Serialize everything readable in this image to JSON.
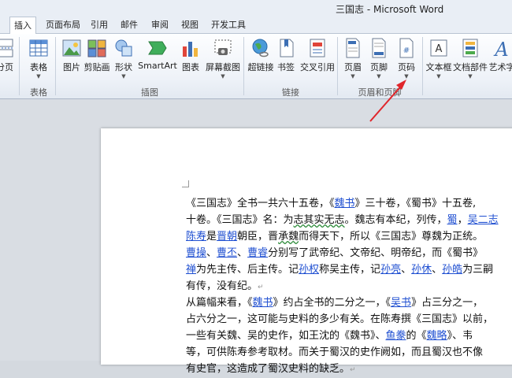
{
  "window": {
    "title": "三国志 - Microsoft Word"
  },
  "tabs": [
    "插入",
    "页面布局",
    "引用",
    "邮件",
    "审阅",
    "视图",
    "开发工具"
  ],
  "ribbon": {
    "partial_left": "分页",
    "buttons": {
      "table": "表格",
      "picture": "图片",
      "clipart": "剪贴画",
      "shapes": "形状",
      "smartart": "SmartArt",
      "chart": "图表",
      "screenshot": "屏幕截图",
      "hyperlink": "超链接",
      "bookmark": "书签",
      "crossref": "交叉引用",
      "header": "页眉",
      "footer": "页脚",
      "pagenum": "页码",
      "textbox": "文本框",
      "quickparts": "文档部件",
      "wordart": "艺术字"
    },
    "groups": {
      "tables": "表格",
      "illustrations": "插图",
      "links": "链接",
      "header_footer": "页眉和页脚"
    }
  },
  "doc": {
    "l1a": "《三国志》全书一共六十五卷，《",
    "l1b": "魏书",
    "l1c": "》三十卷，《蜀书》十五卷,",
    "l2a": "十卷。《三国志》名：为",
    "l2b": "志其实无志",
    "l2c": "。魏志有本纪，列传，",
    "l2d": "蜀",
    "l2e": "，",
    "l2f": "吴二志",
    "l3a": "陈寿",
    "l3b": "是",
    "l3c": "晋朝",
    "l3d": "朝臣，晋",
    "l3e": "承魏",
    "l3f": "而得天下，所以《三国志》尊魏为正统。",
    "l4a": "曹操",
    "l4b": "、",
    "l4c": "曹丕",
    "l4d": "、",
    "l4e": "曹睿",
    "l4f": "分别写了武帝纪、文帝纪、明帝纪，而《蜀书》",
    "l5a": "禅",
    "l5b": "为先主传、后主传。记",
    "l5c": "孙权",
    "l5d": "称吴主传，记",
    "l5e": "孙亮",
    "l5f": "、",
    "l5g": "孙休",
    "l5h": "、",
    "l5i": "孙皓",
    "l5j": "为三嗣",
    "l6": "有传，没有纪。",
    "l7a": "从篇幅来看，《",
    "l7b": "魏书",
    "l7c": "》约占全书的二分之一，《",
    "l7d": "吴书",
    "l7e": "》占三分之一，",
    "l8": "占六分之一，这可能与史料的多少有关。在陈寿撰《三国志》以前，",
    "l9a": "一些有关魏、吴的史作，如王沈的《魏书》、",
    "l9b": "鱼豢",
    "l9c": "的《",
    "l9d": "魏略",
    "l9e": "》、韦",
    "l10": "等，可供陈寿参考取材。而关于蜀汉的史作阙如，而且蜀汉也不像",
    "l11": "有史官，这造成了蜀汉史料的缺乏。",
    "para_mark": "↵"
  },
  "colors": {
    "link": "#1f4fd1",
    "arrow": "#e0252b"
  }
}
